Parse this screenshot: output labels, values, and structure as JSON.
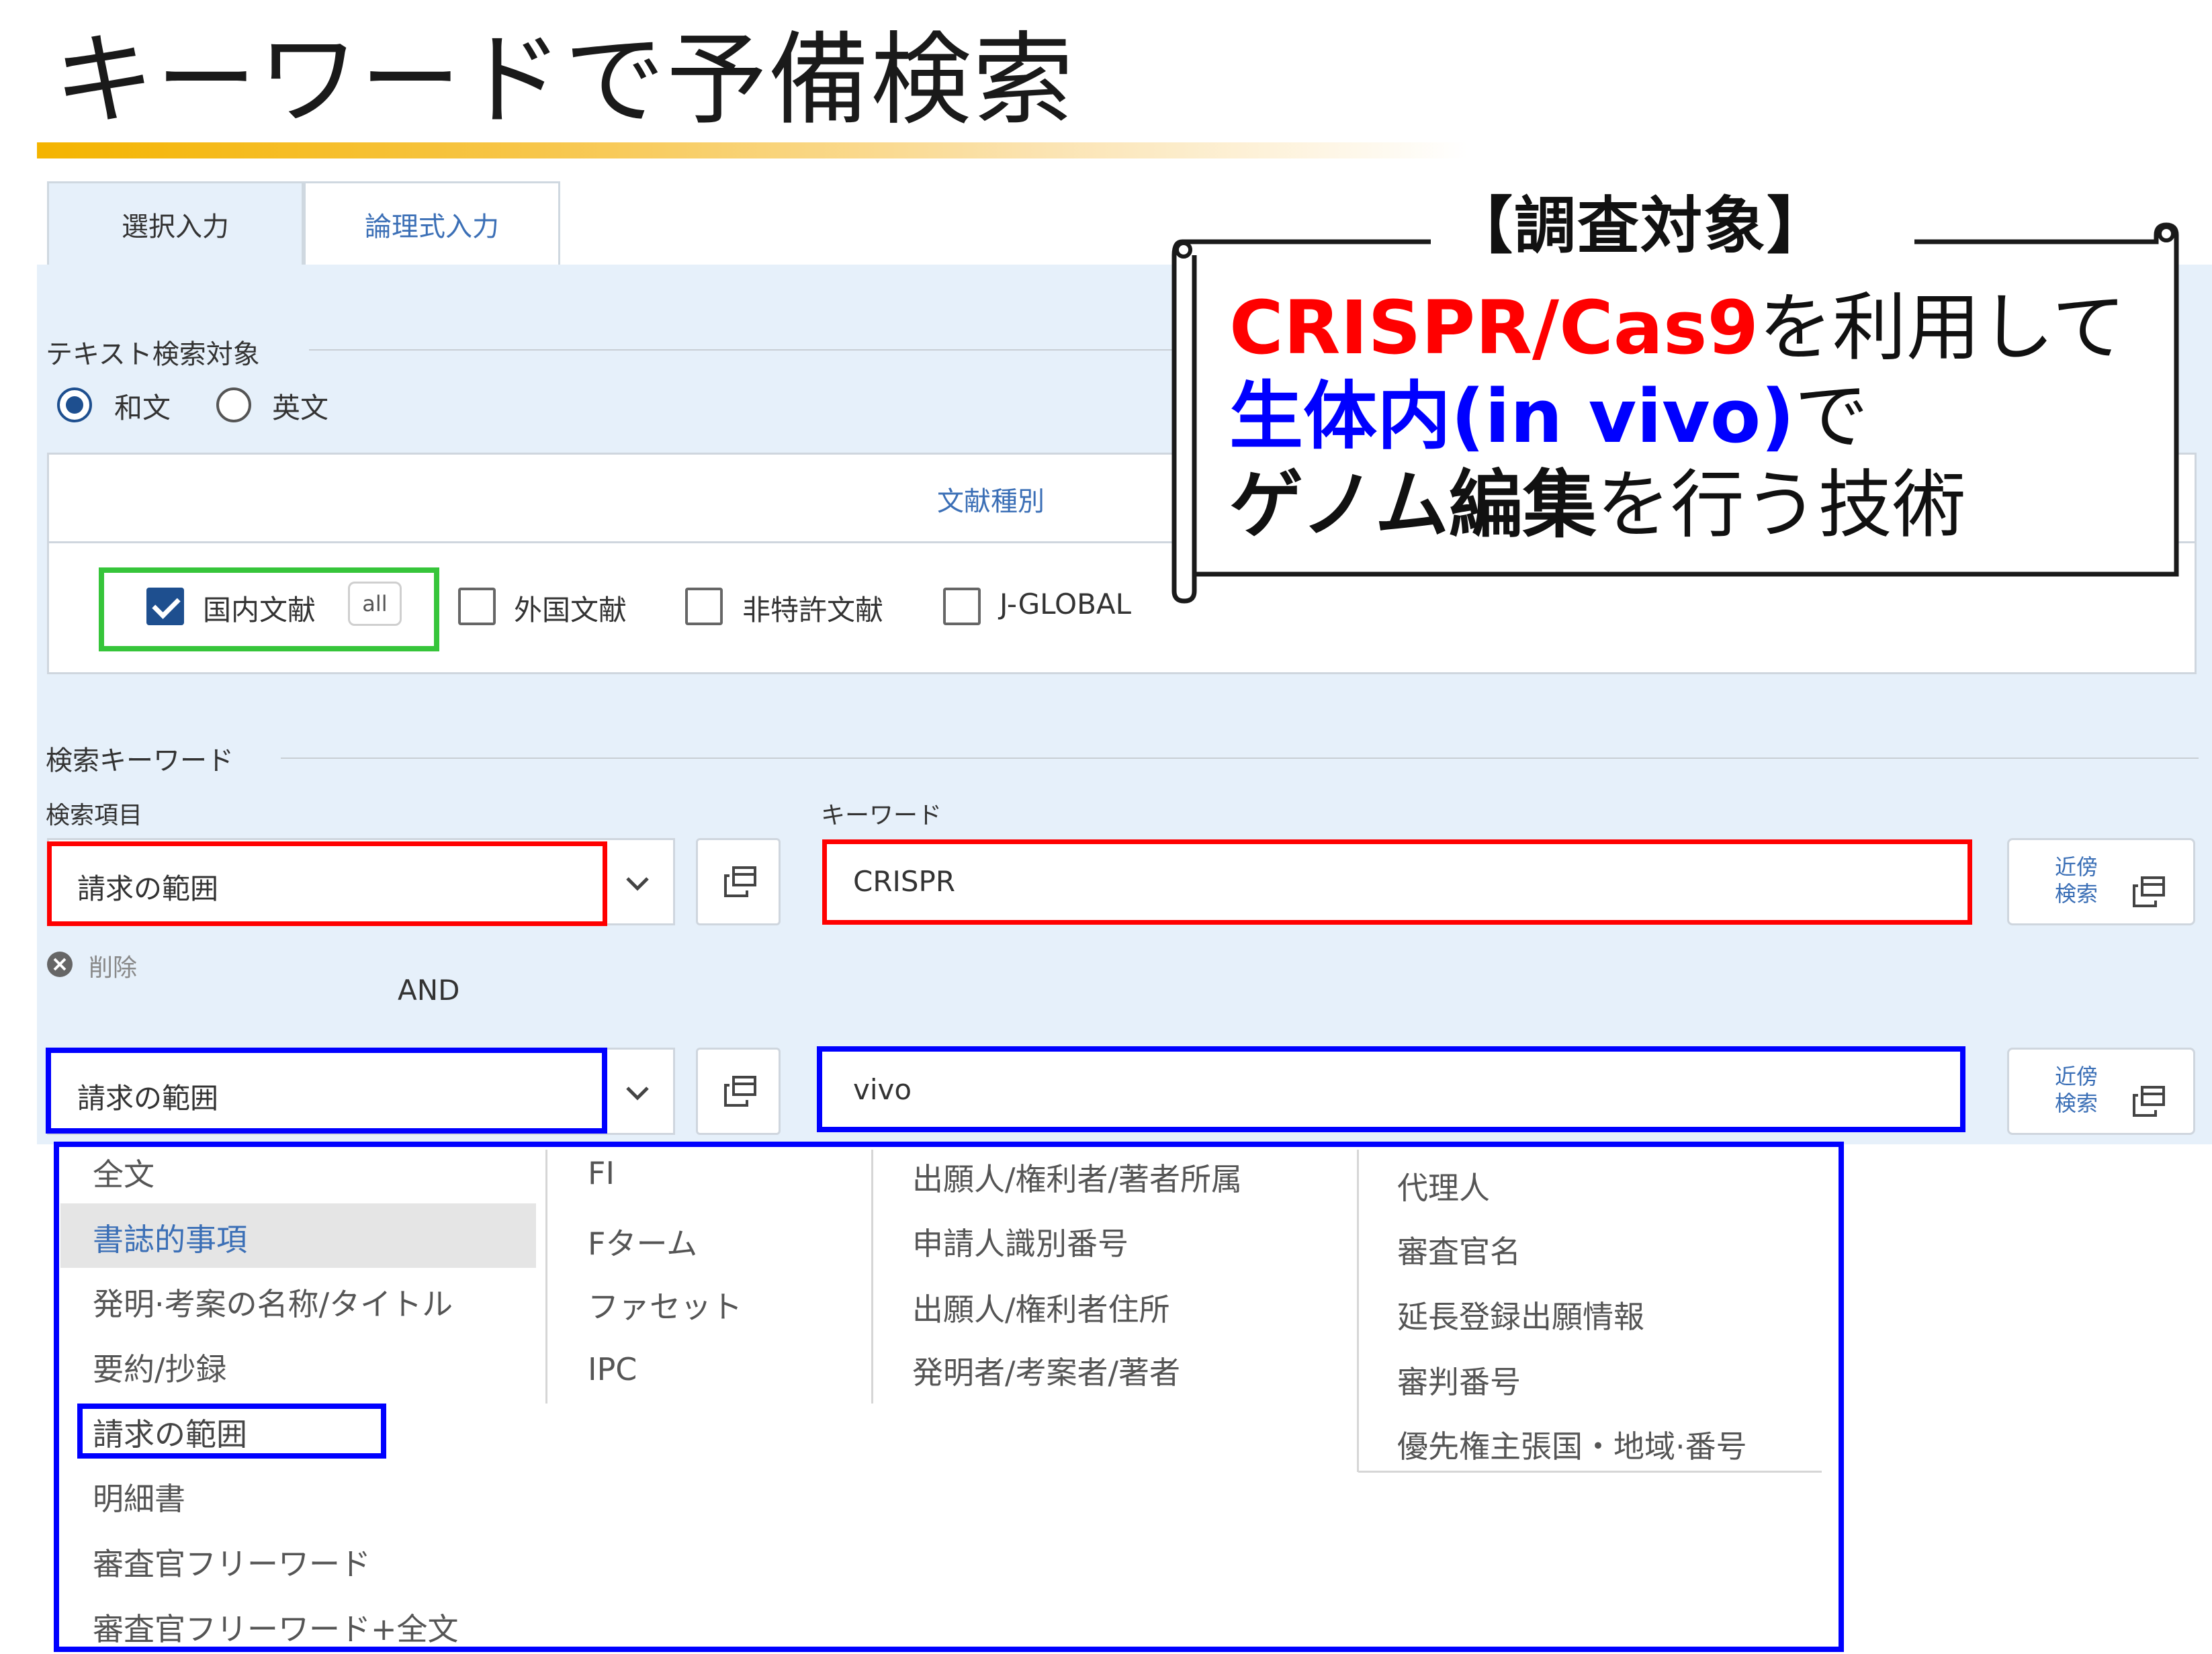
{
  "page": {
    "title": "キーワードで予備検索"
  },
  "tabs": [
    {
      "label": "選択入力",
      "active": true
    },
    {
      "label": "論理式入力",
      "active": false
    }
  ],
  "text_target": {
    "label": "テキスト検索対象",
    "options": [
      {
        "label": "和文",
        "selected": true
      },
      {
        "label": "英文",
        "selected": false
      }
    ]
  },
  "doc_type": {
    "header": "文献種別",
    "items": [
      {
        "label": "国内文献",
        "checked": true,
        "badge": "all"
      },
      {
        "label": "外国文献",
        "checked": false
      },
      {
        "label": "非特許文献",
        "checked": false
      },
      {
        "label": "J-GLOBAL",
        "checked": false
      }
    ]
  },
  "search": {
    "section_label": "検索キーワード",
    "field_label": "検索項目",
    "keyword_label": "キーワード",
    "row1": {
      "field": "請求の範囲",
      "keyword": "CRISPR",
      "near_line1": "近傍",
      "near_line2": "検索"
    },
    "delete_label": "削除",
    "operator": "AND",
    "row2": {
      "field": "請求の範囲",
      "keyword": "vivo",
      "near_line1": "近傍",
      "near_line2": "検索"
    }
  },
  "dropdown": {
    "columns": [
      [
        "全文",
        "書誌的事項",
        "発明·考案の名称/タイトル",
        "要約/抄録",
        "請求の範囲",
        "明細書",
        "審査官フリーワード",
        "審査官フリーワード+全文"
      ],
      [
        "FI",
        "Fターム",
        "ファセット",
        "IPC"
      ],
      [
        "出願人/権利者/著者所属",
        "申請人識別番号",
        "出願人/権利者住所",
        "発明者/考案者/著者"
      ],
      [
        "代理人",
        "審査官名",
        "延長登録出願情報",
        "審判番号",
        "優先権主張国・地域·番号"
      ]
    ],
    "highlighted": "書誌的事項",
    "selected": "請求の範囲"
  },
  "callout": {
    "label": "【調査対象】",
    "line1_highlight": "CRISPR/Cas9",
    "line1_rest": "を利用して",
    "line2_highlight": "生体内(in vivo)",
    "line2_rest": "で",
    "line3_bold": "ゲノム編集",
    "line3_rest": "を行う技術"
  },
  "colors": {
    "accent_red": "#ff0000",
    "accent_blue": "#0000ff",
    "accent_green": "#36c53a",
    "panel_bg": "#e6f0fa",
    "link_blue": "#3b6fb6"
  }
}
